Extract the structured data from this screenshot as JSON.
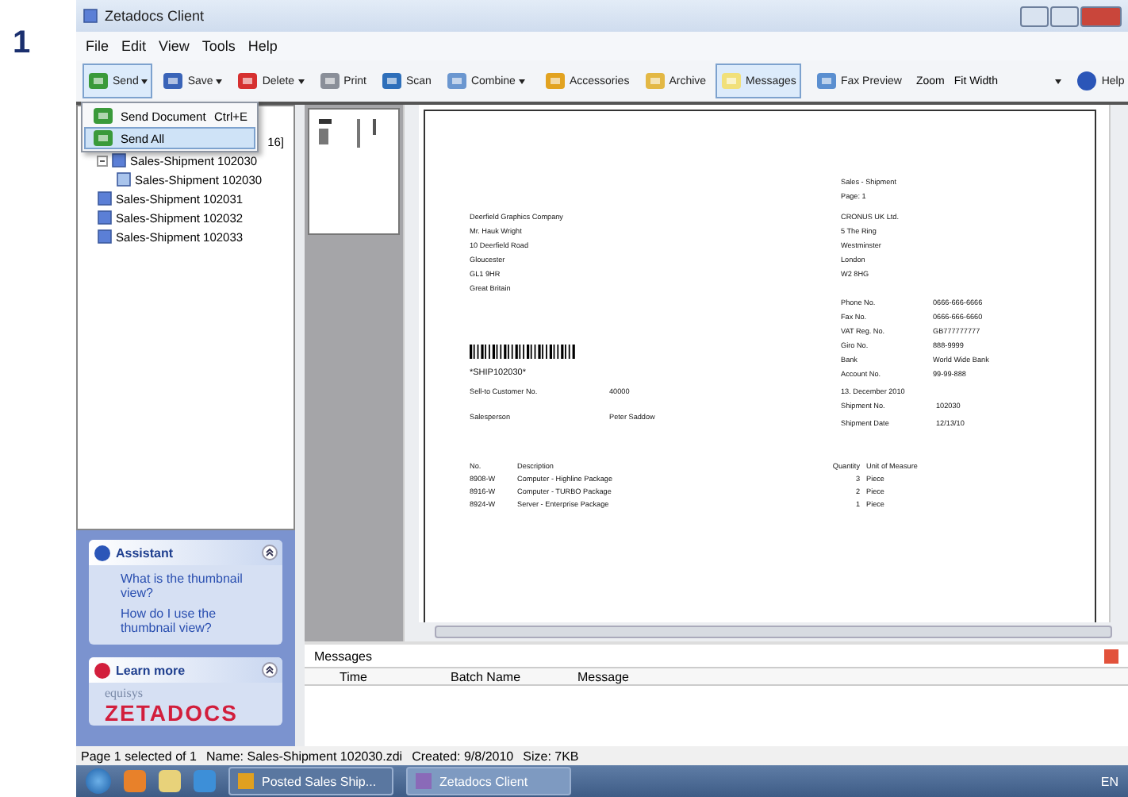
{
  "step": "1",
  "window": {
    "title": "Zetadocs Client"
  },
  "menu": [
    "File",
    "Edit",
    "View",
    "Tools",
    "Help"
  ],
  "toolbar": [
    {
      "label": "Send",
      "kind": "split",
      "open": true
    },
    {
      "label": "Save",
      "kind": "split",
      "open": false
    },
    {
      "label": "Delete",
      "kind": "split",
      "open": false
    },
    {
      "label": "Print",
      "kind": "button",
      "open": false
    },
    {
      "label": "Scan",
      "kind": "button",
      "open": false
    },
    {
      "label": "Combine",
      "kind": "split",
      "open": false
    },
    {
      "label": "Accessories",
      "kind": "button",
      "open": false
    },
    {
      "label": "Archive",
      "kind": "button",
      "open": false
    },
    {
      "label": "Messages",
      "kind": "toggle",
      "selected": true
    },
    {
      "label": "Fax Preview",
      "kind": "button",
      "open": false
    }
  ],
  "zoom": {
    "label": "Zoom",
    "value": "Fit Width"
  },
  "help": "Help",
  "send_menu": [
    {
      "label": "Send Document",
      "shortcut": "Ctrl+E",
      "selected": false
    },
    {
      "label": "Send All",
      "selected": true
    }
  ],
  "tree": [
    {
      "label": "16]",
      "children": [
        {
          "label": "Sales-Shipment  102030",
          "expanded": true,
          "children": [
            {
              "label": "Sales-Shipment  102030"
            }
          ]
        },
        {
          "label": "Sales-Shipment  102031",
          "expanded": false
        },
        {
          "label": "Sales-Shipment  102032",
          "expanded": false
        },
        {
          "label": "Sales-Shipment  102033",
          "expanded": false
        }
      ]
    }
  ],
  "assistant": {
    "title": "Assistant",
    "links": [
      "What is the thumbnail view?",
      "How do I use the thumbnail view?"
    ]
  },
  "learn_more": {
    "title": "Learn more",
    "brand_small": "equisys",
    "brand": "ZETADOCS"
  },
  "document": {
    "header": [
      "Sales - Shipment",
      "Page: 1"
    ],
    "bill_to": [
      "Deerfield Graphics Company",
      "Mr. Hauk Wright",
      "10 Deerfield Road",
      "Gloucester",
      "GL1 9HR",
      "Great Britain"
    ],
    "company": [
      "CRONUS UK Ltd.",
      "5 The Ring",
      "Westminster",
      "London",
      "W2 8HG"
    ],
    "company_info": [
      [
        "Phone No.",
        "0666-666-6666"
      ],
      [
        "Fax No.",
        "0666-666-6660"
      ],
      [
        "VAT Reg. No.",
        "GB777777777"
      ],
      [
        "Giro No.",
        "888-9999"
      ],
      [
        "Bank",
        "World Wide Bank"
      ],
      [
        "Account No.",
        "99-99-888"
      ]
    ],
    "barcode_text": "*SHIP102030*",
    "date": "13. December 2010",
    "left_fields": [
      [
        "Sell-to Customer No.",
        "40000"
      ],
      [
        "Salesperson",
        "Peter Saddow"
      ]
    ],
    "right_fields": [
      [
        "Shipment No.",
        "102030"
      ],
      [
        "Shipment Date",
        "12/13/10"
      ]
    ],
    "columns": [
      "No.",
      "Description",
      "Quantity",
      "Unit of Measure"
    ],
    "lines": [
      [
        "8908-W",
        "Computer - Highline Package",
        "3",
        "Piece"
      ],
      [
        "8916-W",
        "Computer - TURBO Package",
        "2",
        "Piece"
      ],
      [
        "8924-W",
        "Server - Enterprise Package",
        "1",
        "Piece"
      ]
    ]
  },
  "messages": {
    "title": "Messages",
    "columns": [
      "Time",
      "Batch Name",
      "Message"
    ]
  },
  "status_bar": [
    "Page 1 selected of 1",
    "Name: Sales-Shipment  102030.zdi",
    "Created: 9/8/2010",
    "Size: 7KB"
  ],
  "taskbar": {
    "apps": [
      {
        "label": "Posted Sales Ship...",
        "selected": false
      },
      {
        "label": "Zetadocs Client",
        "selected": true
      }
    ],
    "language": "EN"
  }
}
